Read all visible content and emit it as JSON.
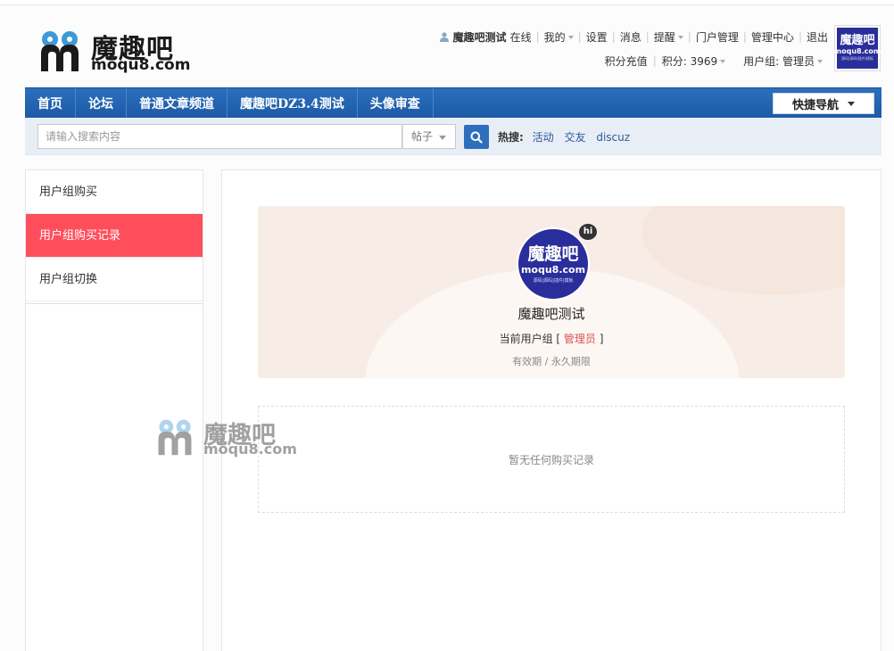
{
  "site": {
    "logo_cn": "魔趣吧",
    "logo_en": "moqu8.com"
  },
  "userbar": {
    "username": "魔趣吧测试",
    "status": "在线",
    "links": [
      "我的",
      "设置",
      "消息",
      "提醒",
      "门户管理",
      "管理中心",
      "退出"
    ],
    "recharge": "积分充值",
    "points": "积分: 3969",
    "group": "用户组: 管理员"
  },
  "avatar_top": {
    "line1": "魔趣吧",
    "line2": "moqu8.com",
    "line3": "源码|源码|插件|模板"
  },
  "nav": {
    "items": [
      "首页",
      "论坛",
      "普通文章频道",
      "魔趣吧DZ3.4测试",
      "头像审查"
    ],
    "quick": "快捷导航"
  },
  "search": {
    "placeholder": "请输入搜索内容",
    "type": "帖子",
    "hot_label": "热搜:",
    "hot": [
      "活动",
      "交友",
      "discuz"
    ]
  },
  "sidebar": {
    "items": [
      "用户组购买",
      "用户组购买记录",
      "用户组切换"
    ],
    "active_index": 1
  },
  "profile": {
    "avatar_line1": "魔趣吧",
    "avatar_line2": "moqu8.com",
    "avatar_line3": "源码|源码|插件|模板",
    "badge": "hi",
    "name": "魔趣吧测试",
    "group_prefix": "当前用户组 [",
    "group_name": "管理员",
    "group_suffix": "]",
    "validity": "有效期 / 永久期限"
  },
  "records": {
    "empty_text": "暂无任何购买记录"
  },
  "watermark": {
    "cn": "魔趣吧",
    "en": "moqu8.com"
  },
  "colors": {
    "nav": "#1d5aa6",
    "active_menu": "#ff4e5b",
    "group_highlight": "#d9534f",
    "avatar_bg": "#2a2e9b"
  }
}
